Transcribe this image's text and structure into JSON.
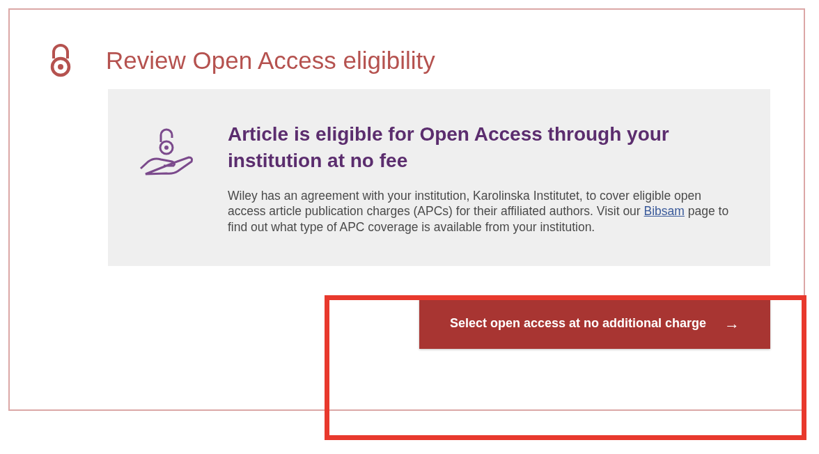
{
  "title": "Review Open Access eligibility",
  "notice": {
    "heading": "Article is eligible for Open Access through your institution at no fee",
    "text_before": "Wiley has an agreement with your institution, Karolinska Institutet, to cover eligible open access article publication charges (APCs) for their affiliated authors. Visit our ",
    "link": "Bibsam",
    "text_after": " page to find out what type of APC coverage is available from your institution."
  },
  "button": {
    "label": "Select open access at no additional charge",
    "arrow": "→",
    "highlighted": true
  }
}
